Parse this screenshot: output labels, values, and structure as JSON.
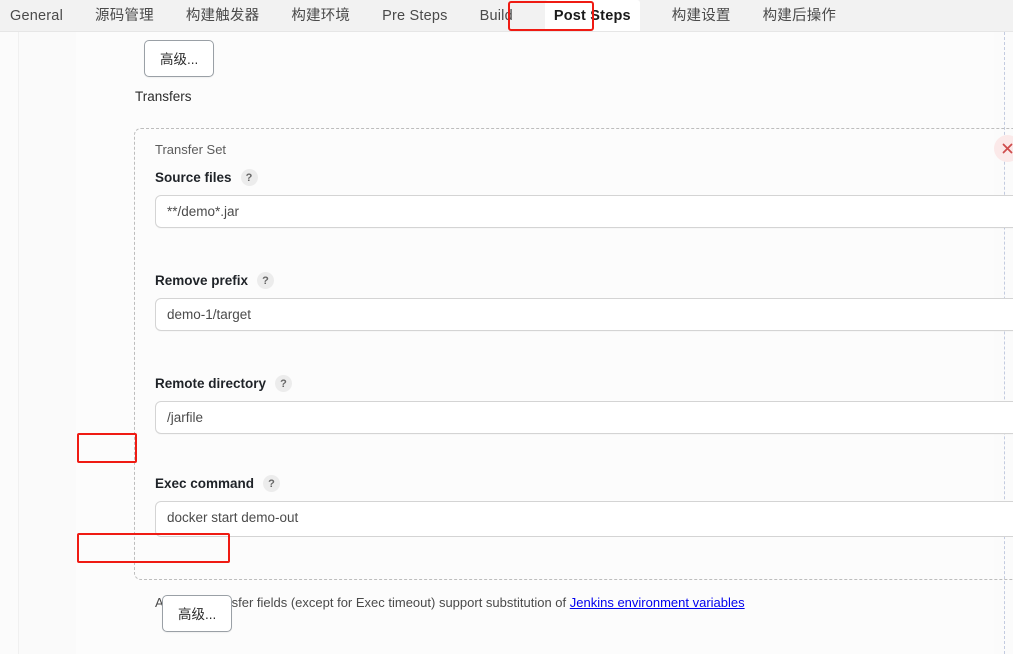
{
  "tabs": [
    {
      "label": "General",
      "active": false
    },
    {
      "label": "源码管理",
      "active": false
    },
    {
      "label": "构建触发器",
      "active": false
    },
    {
      "label": "构建环境",
      "active": false
    },
    {
      "label": "Pre Steps",
      "active": false
    },
    {
      "label": "Build",
      "active": false
    },
    {
      "label": "Post Steps",
      "active": true
    },
    {
      "label": "构建设置",
      "active": false
    },
    {
      "label": "构建后操作",
      "active": false
    }
  ],
  "content": {
    "advanced_top_label": "高级...",
    "advanced_bottom_label": "高级...",
    "transfers_label": "Transfers",
    "transfer_set": {
      "title": "Transfer Set",
      "delete_icon": "close-icon",
      "help_icon": "?",
      "fields": [
        {
          "label": "Source files",
          "value": "**/demo*.jar",
          "type": "input",
          "highlighted": false
        },
        {
          "label": "Remove prefix",
          "value": "demo-1/target",
          "type": "input",
          "highlighted": false
        },
        {
          "label": "Remote directory",
          "value": "/jarfile",
          "type": "input",
          "highlighted": true
        },
        {
          "label": "Exec command",
          "value": "docker start demo-out",
          "type": "textarea",
          "highlighted": true
        }
      ],
      "note_prefix": "All of the transfer fields (except for Exec timeout) support substitution of ",
      "note_link": "Jenkins environment variables"
    }
  },
  "colors": {
    "annotation": "#ef1b13",
    "link": "#1f5fd1",
    "tab_active_text": "#1b1b1b"
  }
}
